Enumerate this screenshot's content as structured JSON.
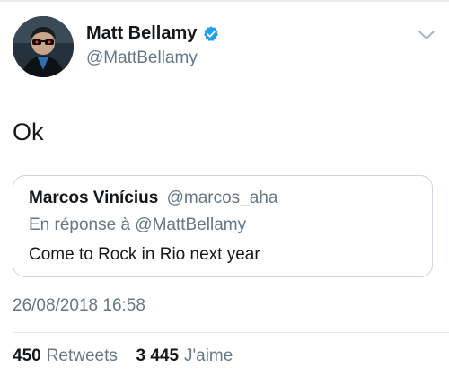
{
  "author": {
    "display_name": "Matt Bellamy",
    "handle": "@MattBellamy",
    "verified": true
  },
  "tweet": {
    "text": "Ok",
    "timestamp": "26/08/2018 16:58"
  },
  "quoted_tweet": {
    "author_name": "Marcos Vinícius",
    "author_handle": "@marcos_aha",
    "reply_context": "En réponse à @MattBellamy",
    "text": "Come to Rock in Rio next year"
  },
  "stats": {
    "retweets_count": "450",
    "retweets_label": "Retweets",
    "likes_count": "3 445",
    "likes_label": "J'aime"
  },
  "colors": {
    "primary_text": "#14171a",
    "secondary_text": "#657786",
    "verified_blue": "#1da1f2",
    "border": "#ccd6dd"
  },
  "icons": {
    "verified": "verified-badge-icon",
    "menu": "chevron-down-icon"
  }
}
